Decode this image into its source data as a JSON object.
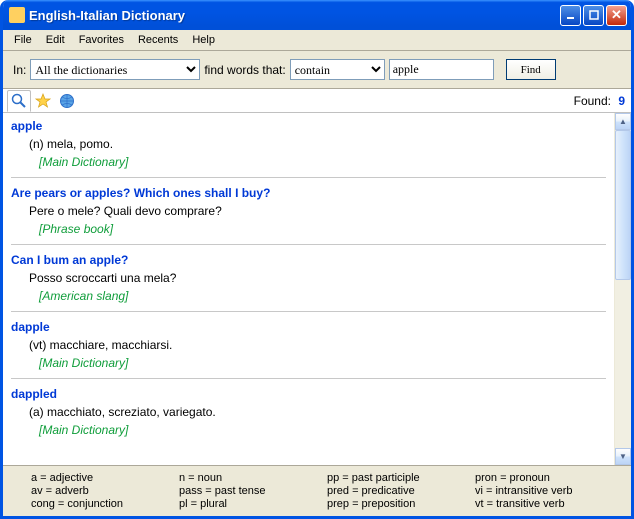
{
  "window": {
    "title": "English-Italian Dictionary"
  },
  "menu": {
    "items": [
      "File",
      "Edit",
      "Favorites",
      "Recents",
      "Help"
    ]
  },
  "search": {
    "in_label": "In:",
    "dict_value": "All the dictionaries",
    "mid_label": "find words that:",
    "mode_value": "contain",
    "query": "apple",
    "find_label": "Find"
  },
  "found": {
    "label": "Found:",
    "count": "9"
  },
  "entries": [
    {
      "title": "apple",
      "def": "(n) mela, pomo.",
      "src": "[Main Dictionary]"
    },
    {
      "title": "Are pears or apples? Which ones shall I buy?",
      "def": "Pere o mele? Quali devo comprare?",
      "src": "[Phrase book]"
    },
    {
      "title": "Can I bum an apple?",
      "def": "Posso scroccarti una mela?",
      "src": "[American slang]"
    },
    {
      "title": "dapple",
      "def": "(vt) macchiare, macchiarsi.",
      "src": "[Main Dictionary]"
    },
    {
      "title": "dappled",
      "def": "(a) macchiato, screziato, variegato.",
      "src": "[Main Dictionary]"
    }
  ],
  "legend": {
    "col1": [
      "a = adjective",
      "av = adverb",
      "cong = conjunction"
    ],
    "col2": [
      "n = noun",
      "pass = past tense",
      "pl = plural"
    ],
    "col3": [
      "pp = past participle",
      "pred = predicative",
      "prep = preposition"
    ],
    "col4": [
      "pron = pronoun",
      "vi = intransitive verb",
      "vt = transitive verb"
    ]
  }
}
